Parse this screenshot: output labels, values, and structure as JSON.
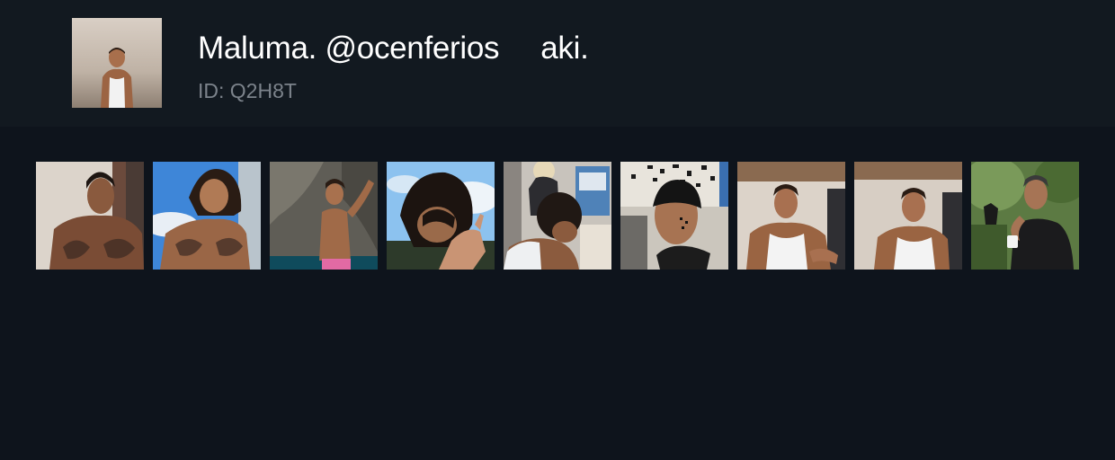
{
  "profile": {
    "name": "Maluma.",
    "handle": "@ocenferios",
    "suffix": "aki.",
    "id_label": "ID: Q2H8T",
    "avatar_icon": "profile-photo"
  },
  "thumbnails": [
    {
      "name": "video-thumbnail-1",
      "scene": "shirtless-indoor",
      "bg": "#d8d1c8"
    },
    {
      "name": "video-thumbnail-2",
      "scene": "shirtless-sky",
      "bg": "#3f86d8"
    },
    {
      "name": "video-thumbnail-3",
      "scene": "shirtless-rocks",
      "bg": "#6d6a62"
    },
    {
      "name": "video-thumbnail-4",
      "scene": "wet-hair-sky",
      "bg": "#8fc2ee"
    },
    {
      "name": "video-thumbnail-5",
      "scene": "hair-styling",
      "bg": "#b9b5b0"
    },
    {
      "name": "video-thumbnail-6",
      "scene": "durag-selfie",
      "bg": "#cfcac2"
    },
    {
      "name": "video-thumbnail-7",
      "scene": "tank-top-kitchen",
      "bg": "#d8cfc6"
    },
    {
      "name": "video-thumbnail-8",
      "scene": "tank-top-kitchen-2",
      "bg": "#d5ccc2"
    },
    {
      "name": "video-thumbnail-9",
      "scene": "black-tee-garden",
      "bg": "#5f7d45"
    }
  ]
}
